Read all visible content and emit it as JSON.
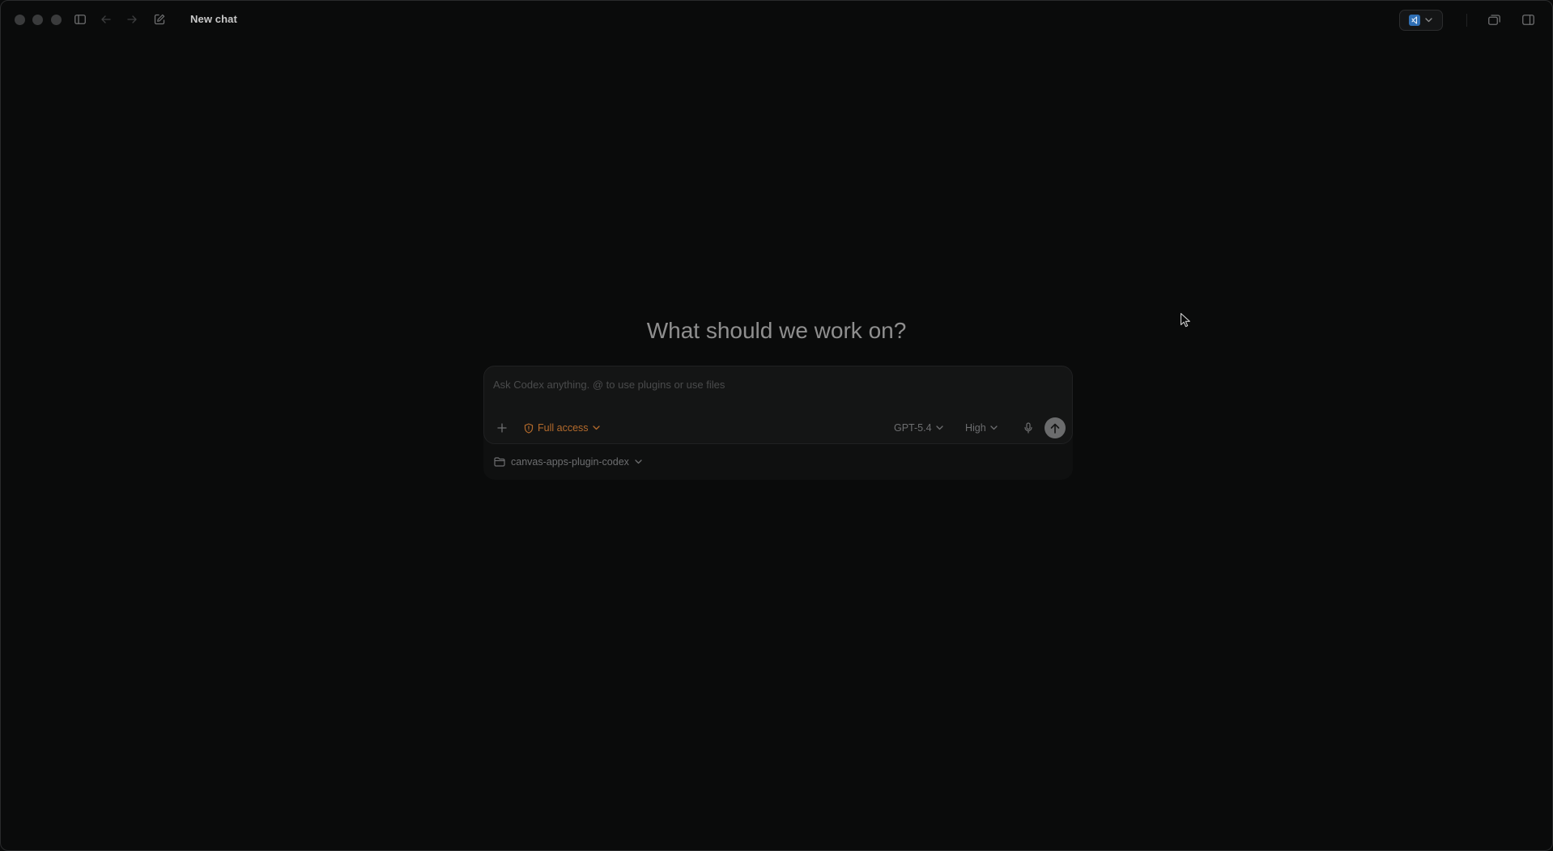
{
  "window": {
    "title": "New chat"
  },
  "main": {
    "heading": "What should we work on?"
  },
  "composer": {
    "placeholder": "Ask Codex anything. @ to use plugins or use files",
    "value": "",
    "access_label": "Full access",
    "model_label": "GPT-5.4",
    "effort_label": "High",
    "project_label": "canvas-apps-plugin-codex"
  },
  "colors": {
    "background": "#0a0b0b",
    "access_accent": "#b36a2c",
    "muted_text": "#6d6e70",
    "heading_text": "#8f8f8f"
  },
  "icons": {
    "sidebar_toggle": "sidebar-icon",
    "back": "arrow-left-icon",
    "forward": "arrow-right-icon",
    "compose": "compose-icon",
    "editor": "vscode-icon",
    "pop_out": "pop-out-icon",
    "panel": "panel-right-icon",
    "add": "plus-icon",
    "access": "shield-icon",
    "mic": "mic-icon",
    "send": "arrow-up-icon",
    "folder": "folder-icon"
  }
}
